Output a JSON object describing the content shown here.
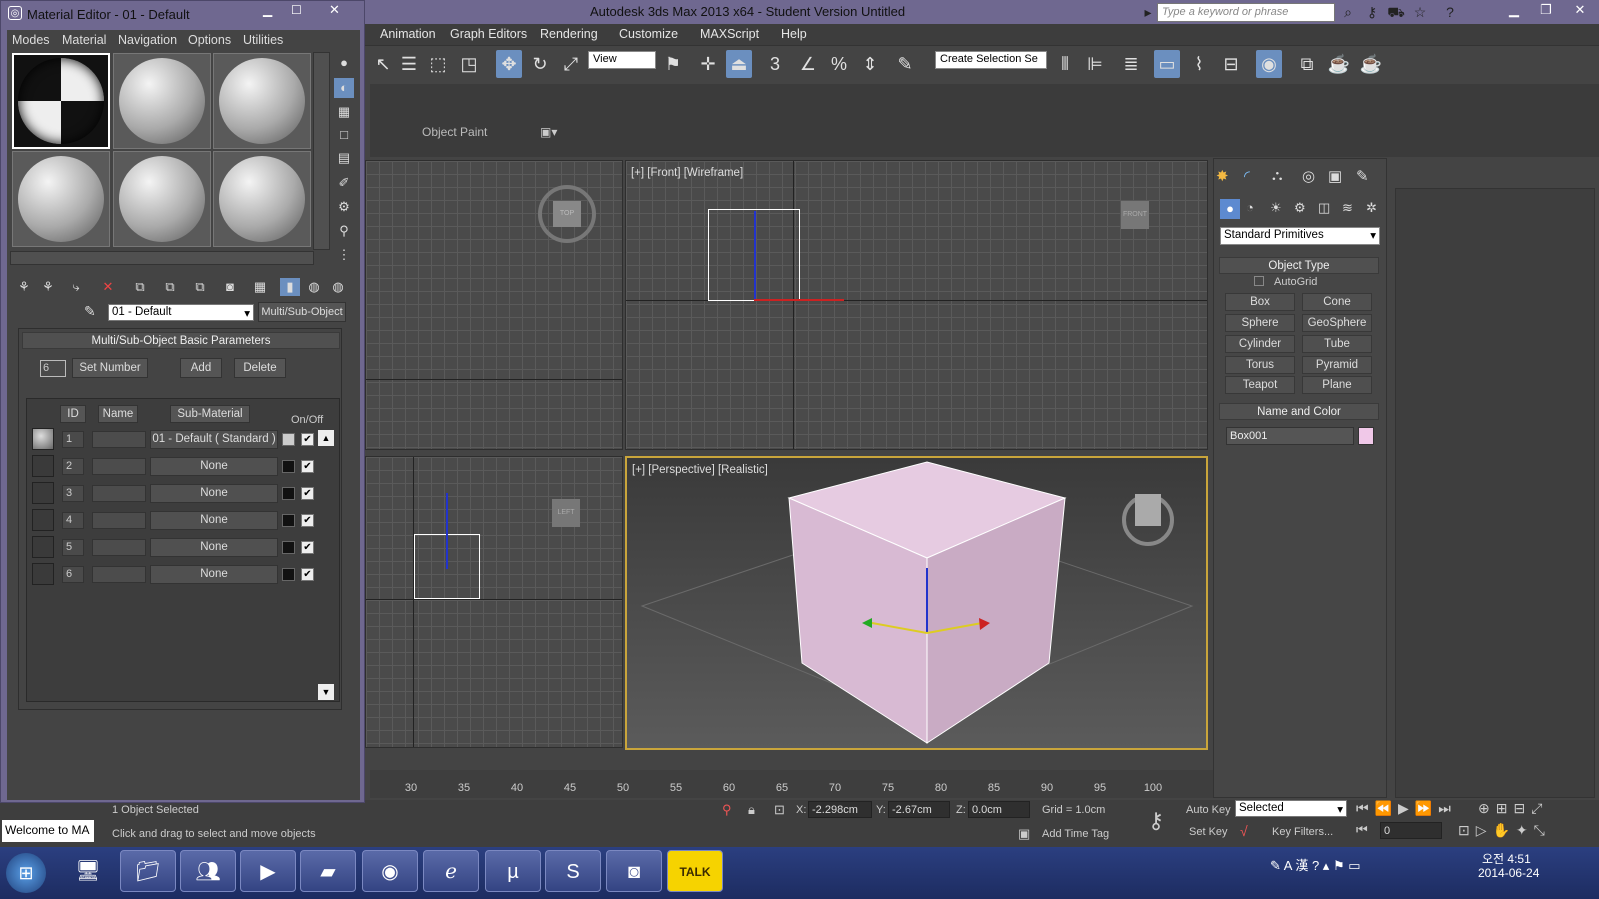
{
  "app": {
    "title": "Autodesk 3ds Max  2013 x64  - Student Version    Untitled",
    "search_placeholder": "Type a keyword or phrase"
  },
  "menu": [
    "Animation",
    "Graph Editors",
    "Rendering",
    "Customize",
    "MAXScript",
    "Help"
  ],
  "toolbar": {
    "view_dd": "View",
    "selection_set": "Create Selection Se"
  },
  "ribbon": {
    "object_paint": "Object Paint"
  },
  "viewports": {
    "front": "[+] [Front] [Wireframe]",
    "perspective": "[+] [Perspective] [Realistic]",
    "top_cube": "TOP",
    "front_cube": "FRONT",
    "left_cube": "LEFT"
  },
  "timeline": {
    "ticks": [
      "30",
      "35",
      "40",
      "45",
      "50",
      "55",
      "60",
      "65",
      "70",
      "75",
      "80",
      "85",
      "90",
      "95",
      "100"
    ]
  },
  "command_panel": {
    "category": "Standard Primitives",
    "object_type_header": "Object Type",
    "autogrid": "AutoGrid",
    "buttons": [
      "Box",
      "Cone",
      "Sphere",
      "GeoSphere",
      "Cylinder",
      "Tube",
      "Torus",
      "Pyramid",
      "Teapot",
      "Plane"
    ],
    "name_color_header": "Name and Color",
    "object_name": "Box001",
    "object_color": "#f0c8e8"
  },
  "status": {
    "welcome": "Welcome to MA",
    "selected": "1 Object Selected",
    "prompt": "Click and drag to select and move objects",
    "x_label": "X:",
    "x": "-2.298cm",
    "y_label": "Y:",
    "y": "-2.67cm",
    "z_label": "Z:",
    "z": "0.0cm",
    "grid": "Grid = 1.0cm",
    "add_time_tag": "Add Time Tag",
    "auto_key": "Auto Key",
    "set_key": "Set Key",
    "key_mode": "Selected",
    "key_filters": "Key Filters...",
    "frame": "0"
  },
  "clock": {
    "time": "오전 4:51",
    "date": "2014-06-24"
  },
  "material_editor": {
    "title": "Material Editor - 01 - Default",
    "menus": [
      "Modes",
      "Material",
      "Navigation",
      "Options",
      "Utilities"
    ],
    "material_name": "01 - Default",
    "material_type": "Multi/Sub-Object",
    "rollout": "Multi/Sub-Object Basic Parameters",
    "count": "6",
    "set_number": "Set Number",
    "add": "Add",
    "delete": "Delete",
    "headers": {
      "id": "ID",
      "name": "Name",
      "sub": "Sub-Material",
      "onoff": "On/Off"
    },
    "rows": [
      {
        "id": "1",
        "sub": "01 - Default  ( Standard )"
      },
      {
        "id": "2",
        "sub": "None"
      },
      {
        "id": "3",
        "sub": "None"
      },
      {
        "id": "4",
        "sub": "None"
      },
      {
        "id": "5",
        "sub": "None"
      },
      {
        "id": "6",
        "sub": "None"
      }
    ]
  }
}
